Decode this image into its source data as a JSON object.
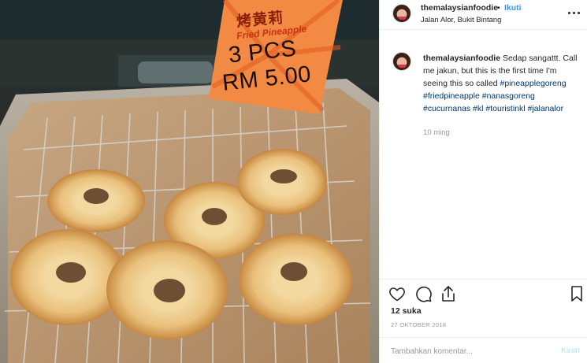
{
  "photo": {
    "sign": {
      "chinese": "烤黄莉",
      "english": "Fried Pineapple",
      "quantity": "3 PCS",
      "price": "RM 5.00"
    }
  },
  "post": {
    "username": "themalaysianfoodie",
    "separator": "•",
    "follow_label": "Ikuti",
    "location": "Jalan Alor, Bukit Bintang",
    "caption": {
      "username": "themalaysianfoodie",
      "text": "Sedap sangattt. Call me jakun, but this is the first time I'm seeing this so called",
      "hashtags": [
        "#pineapplegoreng",
        "#friedpineapple",
        "#nanasgoreng",
        "#cucurnanas",
        "#kl",
        "#touristinkl",
        "#jalanalor"
      ],
      "time_ago": "10 ming"
    },
    "likes": "12 suka",
    "date": "27 OKTOBER 2018",
    "comment_placeholder": "Tambahkan komentar...",
    "post_label": "Kirim"
  },
  "icons": {
    "more": "more-options-icon",
    "like": "heart-icon",
    "comment": "comment-icon",
    "share": "share-icon",
    "save": "bookmark-icon"
  },
  "colors": {
    "link_blue": "#3897f0",
    "hashtag": "#003569",
    "muted": "#999999",
    "post_disabled": "#b2dffc"
  }
}
